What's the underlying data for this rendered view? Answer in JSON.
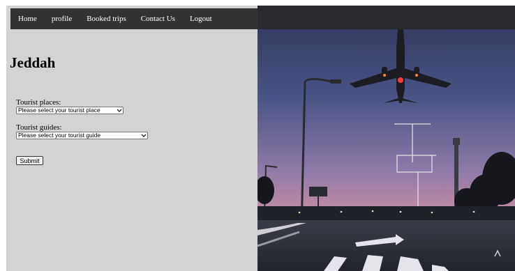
{
  "nav": {
    "items": [
      "Home",
      "profile",
      "Booked trips",
      "Contact Us",
      "Logout"
    ]
  },
  "page": {
    "title": "Jeddah"
  },
  "form": {
    "places_label": "Tourist places:",
    "places_selected": "Please select your tourist place",
    "guides_label": "Tourist guides:",
    "guides_selected": "Please select your tourist guide",
    "submit_label": "Submit"
  },
  "colors": {
    "navbar": "#333333",
    "panel": "#d3d3d3",
    "sky_top": "#3a4a78",
    "sky_bottom": "#c48aa0"
  },
  "icons": {
    "select_arrow": "chevron-down-icon",
    "hero": "airplane-landing-photo"
  }
}
